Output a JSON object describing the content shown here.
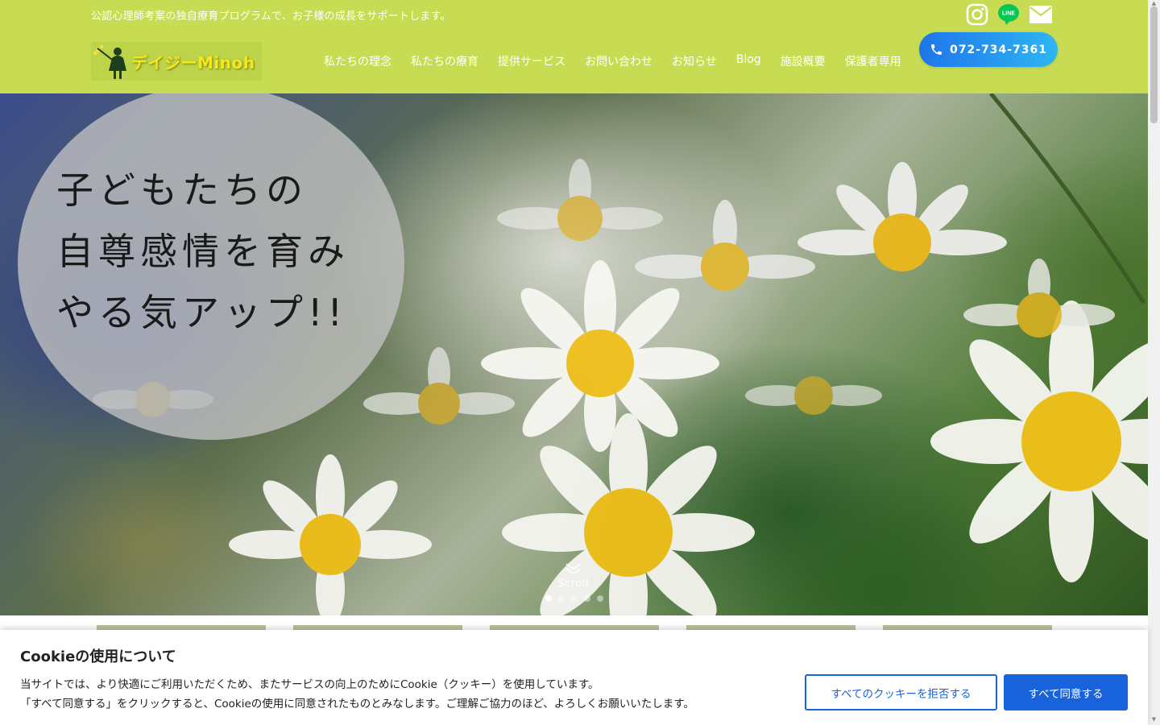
{
  "header": {
    "tagline": "公認心理師考案の独自療育プログラムで、お子様の成長をサポートします。",
    "logo_text": "デイジーMinoh",
    "nav": [
      {
        "label": "私たちの理念"
      },
      {
        "label": "私たちの療育"
      },
      {
        "label": "提供サービス"
      },
      {
        "label": "お問い合わせ"
      },
      {
        "label": "お知らせ"
      },
      {
        "label": "Blog"
      },
      {
        "label": "施設概要"
      },
      {
        "label": "保護者専用"
      }
    ],
    "social": [
      {
        "icon": "instagram-icon"
      },
      {
        "icon": "line-icon",
        "text": "LINE"
      },
      {
        "icon": "mail-icon"
      }
    ],
    "phone": "072-734-7361",
    "colors": {
      "bg": "#c7dc52",
      "phone_gradient_start": "#1f75ea",
      "phone_gradient_end": "#2eb6f2"
    }
  },
  "hero": {
    "lines": [
      "子どもたちの",
      "自尊感情を育み",
      "やる気アップ!!"
    ],
    "scroll_label": "Scroll",
    "slides_total": 5,
    "active_slide": 1
  },
  "cookie": {
    "title": "Cookieの使用について",
    "line1": "当サイトでは、より快適にご利用いただくため、またサービスの向上のためにCookie（クッキー）を使用しています。",
    "line2": "「すべて同意する」をクリックすると、Cookieの使用に同意されたものとみなします。ご理解ご協力のほど、よろしくお願いいたします。",
    "reject_label": "すべてのクッキーを拒否する",
    "accept_label": "すべて同意する",
    "accent": "#1863dc"
  }
}
